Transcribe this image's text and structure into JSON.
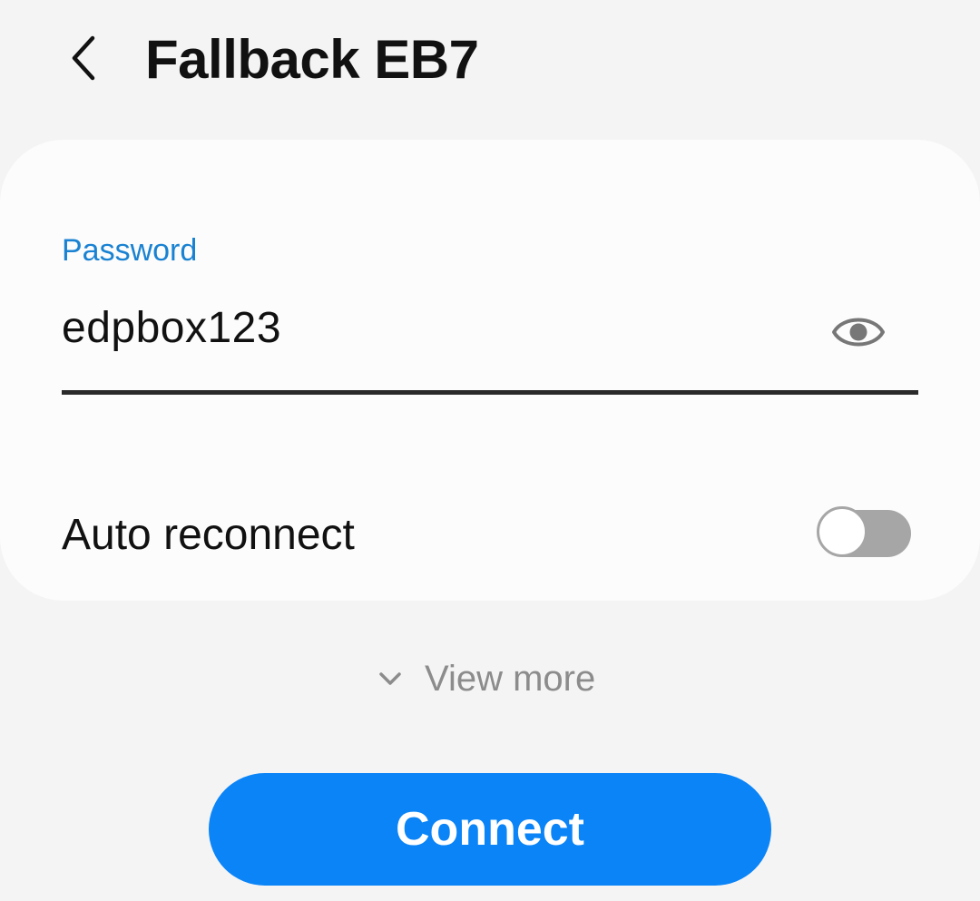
{
  "header": {
    "title": "Fallback EB7",
    "back_icon": "chevron-left-icon"
  },
  "password": {
    "label": "Password",
    "value": "edpbox123",
    "visibility_icon": "eye-icon",
    "label_color": "#1a82d2"
  },
  "auto_reconnect": {
    "label": "Auto reconnect",
    "enabled": false
  },
  "view_more": {
    "label": "View more",
    "icon": "chevron-down-icon"
  },
  "connect_button": {
    "label": "Connect",
    "color": "#0a84f7"
  }
}
